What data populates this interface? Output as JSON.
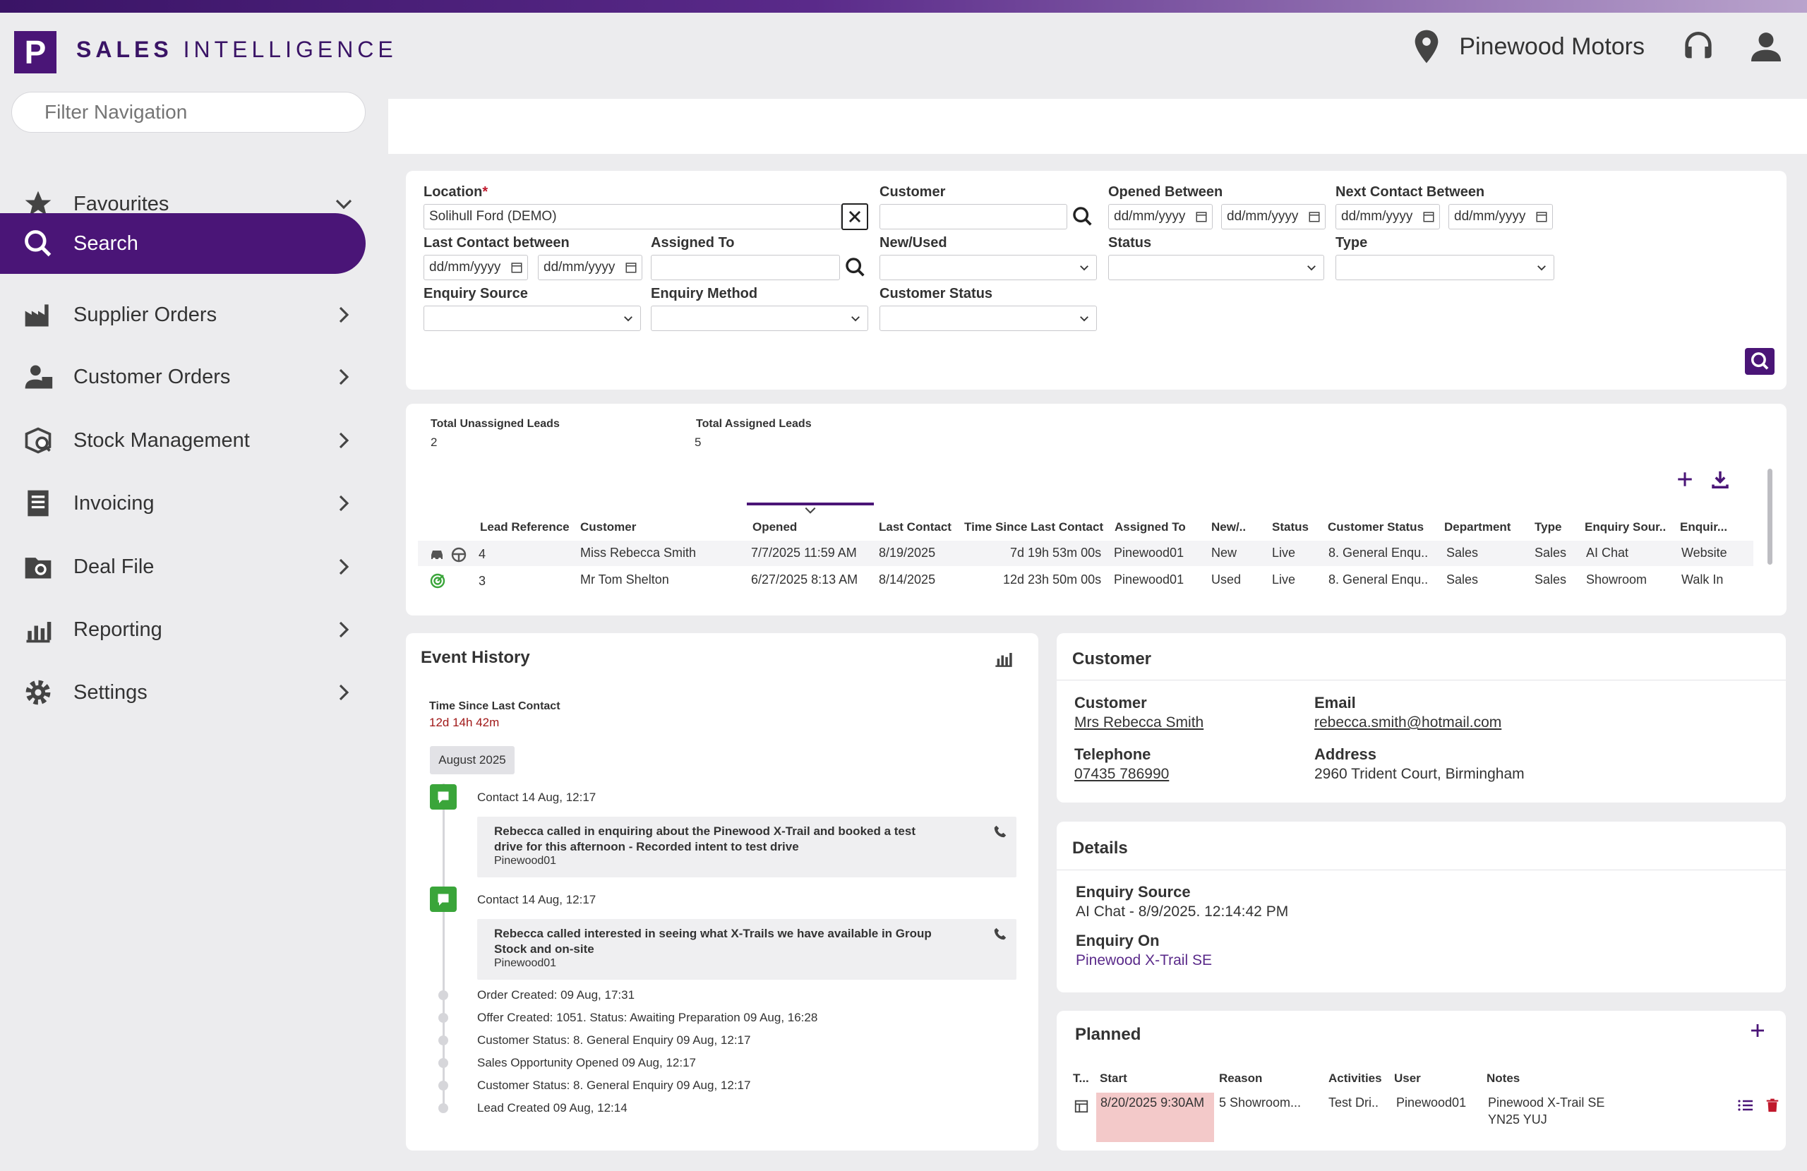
{
  "brand": {
    "logo_letter": "P",
    "sales": "SALES",
    "intelligence": "INTELLIGENCE"
  },
  "header": {
    "location": "Pinewood Motors"
  },
  "sidebar": {
    "filter_placeholder": "Filter Navigation",
    "items": [
      {
        "label": "Favourites",
        "icon": "star-icon"
      },
      {
        "label": "Search",
        "icon": "search-icon"
      },
      {
        "label": "Supplier Orders",
        "icon": "factory-icon"
      },
      {
        "label": "Customer Orders",
        "icon": "customer-icon"
      },
      {
        "label": "Stock Management",
        "icon": "stock-icon"
      },
      {
        "label": "Invoicing",
        "icon": "invoice-icon"
      },
      {
        "label": "Deal File",
        "icon": "deal-file-icon"
      },
      {
        "label": "Reporting",
        "icon": "chart-icon"
      },
      {
        "label": "Settings",
        "icon": "gear-icon"
      }
    ]
  },
  "search": {
    "location_label": "Location",
    "location_required": "*",
    "location_value": "Solihull Ford (DEMO)",
    "customer_label": "Customer",
    "opened_label": "Opened Between",
    "next_contact_label": "Next Contact Between",
    "last_contact_label": "Last Contact between",
    "assigned_label": "Assigned To",
    "new_used_label": "New/Used",
    "status_label": "Status",
    "type_label": "Type",
    "enquiry_source_label": "Enquiry Source",
    "enquiry_method_label": "Enquiry Method",
    "customer_status_label": "Customer Status",
    "date_placeholder": "dd/mm/yyyy"
  },
  "leads": {
    "unassigned_label": "Total Unassigned Leads",
    "unassigned_value": "2",
    "assigned_label": "Total Assigned Leads",
    "assigned_value": "5",
    "columns": [
      "Lead Reference",
      "Customer",
      "Opened",
      "Last Contact",
      "Time Since Last Contact",
      "Assigned To",
      "New/..",
      "Status",
      "Customer Status",
      "Department",
      "Type",
      "Enquiry Sour..",
      "Enquir..."
    ],
    "rows": [
      {
        "ref": "4",
        "customer": "Miss Rebecca Smith",
        "opened": "7/7/2025 11:59 AM",
        "last": "8/19/2025",
        "since": "7d 19h 53m 00s",
        "assigned": "Pinewood01",
        "newused": "New",
        "status": "Live",
        "cstatus": "8. General Enqu..",
        "dept": "Sales",
        "type": "Sales",
        "source": "AI Chat",
        "method": "Website"
      },
      {
        "ref": "3",
        "customer": "Mr Tom Shelton",
        "opened": "6/27/2025 8:13 AM",
        "last": "8/14/2025",
        "since": "12d 23h 50m 00s",
        "assigned": "Pinewood01",
        "newused": "Used",
        "status": "Live",
        "cstatus": "8. General Enqu..",
        "dept": "Sales",
        "type": "Sales",
        "source": "Showroom",
        "method": "Walk In"
      }
    ]
  },
  "events": {
    "title": "Event History",
    "since_label": "Time Since Last Contact",
    "since_value": "12d 14h 42m",
    "month": "August 2025",
    "contacts": [
      {
        "head": "Contact  14 Aug, 12:17",
        "text": "Rebecca called in enquiring about the Pinewood X-Trail and booked a test drive for this afternoon - Recorded intent to test drive",
        "user": "Pinewood01"
      },
      {
        "head": "Contact  14 Aug, 12:17",
        "text": "Rebecca called interested in seeing what X-Trails we have available in Group Stock and on-site",
        "user": "Pinewood01"
      }
    ],
    "items": [
      "Order Created:  09 Aug, 17:31",
      "Offer Created: 1051. Status: Awaiting Preparation  09 Aug, 16:28",
      "Customer Status: 8. General Enquiry  09 Aug, 12:17",
      "Sales Opportunity Opened  09 Aug, 12:17",
      "Customer Status: 8. General Enquiry  09 Aug, 12:17",
      "Lead Created  09 Aug, 12:14"
    ]
  },
  "customer": {
    "title": "Customer",
    "customer_label": "Customer",
    "customer_value": "Mrs Rebecca Smith",
    "email_label": "Email",
    "email_value": "rebecca.smith@hotmail.com",
    "tel_label": "Telephone",
    "tel_value": "07435 786990",
    "address_label": "Address",
    "address_value": "2960 Trident Court, Birmingham"
  },
  "details": {
    "title": "Details",
    "source_label": "Enquiry Source",
    "source_value": "AI Chat - 8/9/2025. 12:14:42 PM",
    "on_label": "Enquiry On",
    "on_value": "Pinewood X-Trail SE"
  },
  "planned": {
    "title": "Planned",
    "columns": [
      "T...",
      "Start",
      "Reason",
      "Activities",
      "User",
      "Notes"
    ],
    "row": {
      "start": "8/20/2025 9:30AM",
      "reason": "5 Showroom...",
      "activities": "Test Dri..",
      "user": "Pinewood01",
      "notes1": "Pinewood X-Trail SE",
      "notes2": "YN25 YUJ"
    }
  },
  "colors": {
    "brand": "#4a1577",
    "highlight": "#f3c9c9",
    "green": "#3aa53a"
  }
}
